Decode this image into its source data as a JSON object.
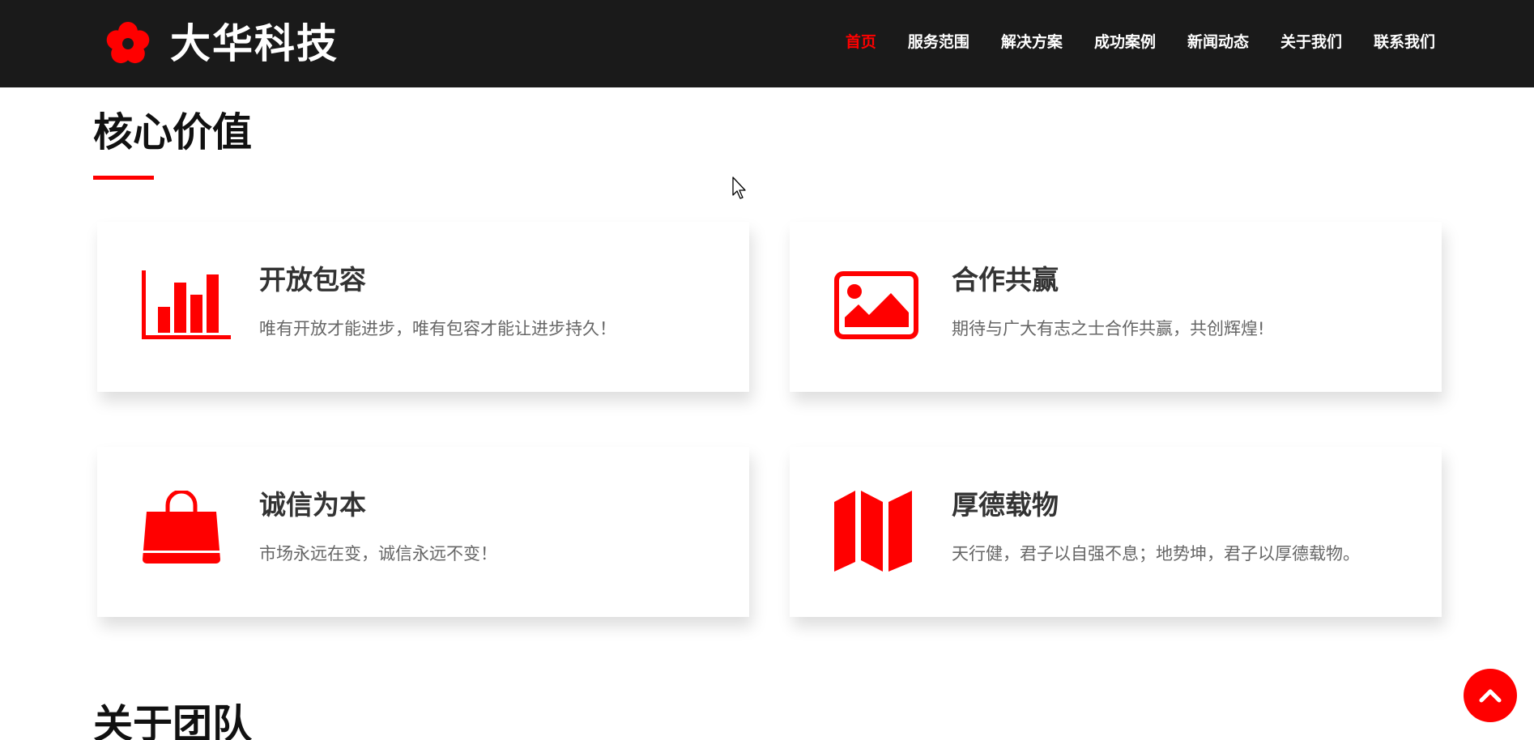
{
  "header": {
    "logo_text": "大华科技",
    "logo_icon": "flower-icon",
    "nav": [
      {
        "label": "首页",
        "active": true
      },
      {
        "label": "服务范围",
        "active": false
      },
      {
        "label": "解决方案",
        "active": false
      },
      {
        "label": "成功案例",
        "active": false
      },
      {
        "label": "新闻动态",
        "active": false
      },
      {
        "label": "关于我们",
        "active": false
      },
      {
        "label": "联系我们",
        "active": false
      }
    ]
  },
  "core_values": {
    "title": "核心价值",
    "cards": [
      {
        "icon": "bar-chart-icon",
        "title": "开放包容",
        "desc": "唯有开放才能进步，唯有包容才能让进步持久！"
      },
      {
        "icon": "image-icon",
        "title": "合作共赢",
        "desc": "期待与广大有志之士合作共赢，共创辉煌!"
      },
      {
        "icon": "shopping-bag-icon",
        "title": "诚信为本",
        "desc": "市场永远在变，诚信永远不变！"
      },
      {
        "icon": "map-icon",
        "title": "厚德载物",
        "desc": "天行健，君子以自强不息；地势坤，君子以厚德载物。"
      }
    ]
  },
  "about_team": {
    "title": "关于团队"
  },
  "back_to_top": {
    "icon": "chevron-up-icon"
  },
  "colors": {
    "accent": "#ff0000",
    "header_bg": "#1a1a1a",
    "card_title": "#333333",
    "card_desc": "#666666"
  }
}
